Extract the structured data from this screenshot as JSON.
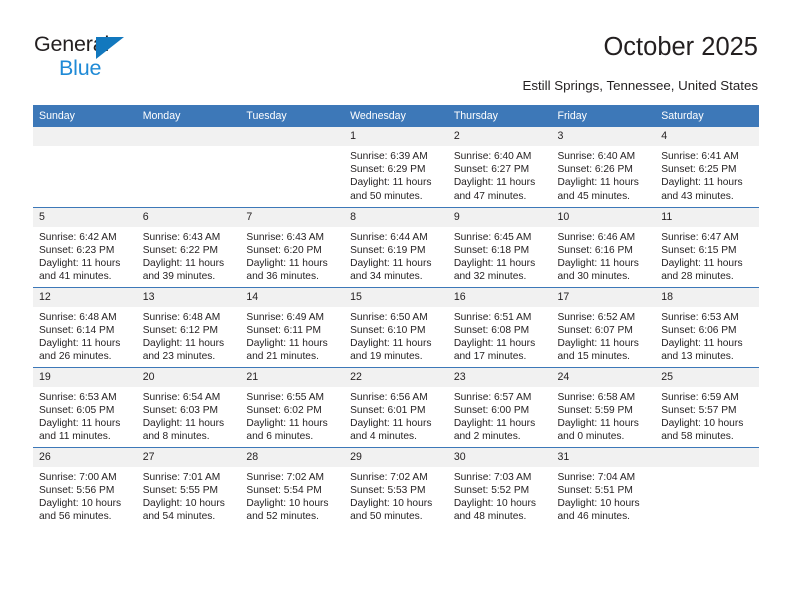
{
  "brand": {
    "name_part1": "General",
    "name_part2": "Blue",
    "triangle_color": "#1278be",
    "blue_text_color": "#1f8ad6"
  },
  "header": {
    "title": "October 2025",
    "location": "Estill Springs, Tennessee, United States"
  },
  "theme": {
    "header_blue": "#3d78b8",
    "daynum_band": "#f1f1f1",
    "text": "#231f20"
  },
  "calendar": {
    "weekday_headers": [
      "Sunday",
      "Monday",
      "Tuesday",
      "Wednesday",
      "Thursday",
      "Friday",
      "Saturday"
    ],
    "weeks": [
      [
        {
          "day": "",
          "sunrise": "",
          "sunset": "",
          "daylight_line1": "",
          "daylight_line2": ""
        },
        {
          "day": "",
          "sunrise": "",
          "sunset": "",
          "daylight_line1": "",
          "daylight_line2": ""
        },
        {
          "day": "",
          "sunrise": "",
          "sunset": "",
          "daylight_line1": "",
          "daylight_line2": ""
        },
        {
          "day": "1",
          "sunrise": "Sunrise: 6:39 AM",
          "sunset": "Sunset: 6:29 PM",
          "daylight_line1": "Daylight: 11 hours",
          "daylight_line2": "and 50 minutes."
        },
        {
          "day": "2",
          "sunrise": "Sunrise: 6:40 AM",
          "sunset": "Sunset: 6:27 PM",
          "daylight_line1": "Daylight: 11 hours",
          "daylight_line2": "and 47 minutes."
        },
        {
          "day": "3",
          "sunrise": "Sunrise: 6:40 AM",
          "sunset": "Sunset: 6:26 PM",
          "daylight_line1": "Daylight: 11 hours",
          "daylight_line2": "and 45 minutes."
        },
        {
          "day": "4",
          "sunrise": "Sunrise: 6:41 AM",
          "sunset": "Sunset: 6:25 PM",
          "daylight_line1": "Daylight: 11 hours",
          "daylight_line2": "and 43 minutes."
        }
      ],
      [
        {
          "day": "5",
          "sunrise": "Sunrise: 6:42 AM",
          "sunset": "Sunset: 6:23 PM",
          "daylight_line1": "Daylight: 11 hours",
          "daylight_line2": "and 41 minutes."
        },
        {
          "day": "6",
          "sunrise": "Sunrise: 6:43 AM",
          "sunset": "Sunset: 6:22 PM",
          "daylight_line1": "Daylight: 11 hours",
          "daylight_line2": "and 39 minutes."
        },
        {
          "day": "7",
          "sunrise": "Sunrise: 6:43 AM",
          "sunset": "Sunset: 6:20 PM",
          "daylight_line1": "Daylight: 11 hours",
          "daylight_line2": "and 36 minutes."
        },
        {
          "day": "8",
          "sunrise": "Sunrise: 6:44 AM",
          "sunset": "Sunset: 6:19 PM",
          "daylight_line1": "Daylight: 11 hours",
          "daylight_line2": "and 34 minutes."
        },
        {
          "day": "9",
          "sunrise": "Sunrise: 6:45 AM",
          "sunset": "Sunset: 6:18 PM",
          "daylight_line1": "Daylight: 11 hours",
          "daylight_line2": "and 32 minutes."
        },
        {
          "day": "10",
          "sunrise": "Sunrise: 6:46 AM",
          "sunset": "Sunset: 6:16 PM",
          "daylight_line1": "Daylight: 11 hours",
          "daylight_line2": "and 30 minutes."
        },
        {
          "day": "11",
          "sunrise": "Sunrise: 6:47 AM",
          "sunset": "Sunset: 6:15 PM",
          "daylight_line1": "Daylight: 11 hours",
          "daylight_line2": "and 28 minutes."
        }
      ],
      [
        {
          "day": "12",
          "sunrise": "Sunrise: 6:48 AM",
          "sunset": "Sunset: 6:14 PM",
          "daylight_line1": "Daylight: 11 hours",
          "daylight_line2": "and 26 minutes."
        },
        {
          "day": "13",
          "sunrise": "Sunrise: 6:48 AM",
          "sunset": "Sunset: 6:12 PM",
          "daylight_line1": "Daylight: 11 hours",
          "daylight_line2": "and 23 minutes."
        },
        {
          "day": "14",
          "sunrise": "Sunrise: 6:49 AM",
          "sunset": "Sunset: 6:11 PM",
          "daylight_line1": "Daylight: 11 hours",
          "daylight_line2": "and 21 minutes."
        },
        {
          "day": "15",
          "sunrise": "Sunrise: 6:50 AM",
          "sunset": "Sunset: 6:10 PM",
          "daylight_line1": "Daylight: 11 hours",
          "daylight_line2": "and 19 minutes."
        },
        {
          "day": "16",
          "sunrise": "Sunrise: 6:51 AM",
          "sunset": "Sunset: 6:08 PM",
          "daylight_line1": "Daylight: 11 hours",
          "daylight_line2": "and 17 minutes."
        },
        {
          "day": "17",
          "sunrise": "Sunrise: 6:52 AM",
          "sunset": "Sunset: 6:07 PM",
          "daylight_line1": "Daylight: 11 hours",
          "daylight_line2": "and 15 minutes."
        },
        {
          "day": "18",
          "sunrise": "Sunrise: 6:53 AM",
          "sunset": "Sunset: 6:06 PM",
          "daylight_line1": "Daylight: 11 hours",
          "daylight_line2": "and 13 minutes."
        }
      ],
      [
        {
          "day": "19",
          "sunrise": "Sunrise: 6:53 AM",
          "sunset": "Sunset: 6:05 PM",
          "daylight_line1": "Daylight: 11 hours",
          "daylight_line2": "and 11 minutes."
        },
        {
          "day": "20",
          "sunrise": "Sunrise: 6:54 AM",
          "sunset": "Sunset: 6:03 PM",
          "daylight_line1": "Daylight: 11 hours",
          "daylight_line2": "and 8 minutes."
        },
        {
          "day": "21",
          "sunrise": "Sunrise: 6:55 AM",
          "sunset": "Sunset: 6:02 PM",
          "daylight_line1": "Daylight: 11 hours",
          "daylight_line2": "and 6 minutes."
        },
        {
          "day": "22",
          "sunrise": "Sunrise: 6:56 AM",
          "sunset": "Sunset: 6:01 PM",
          "daylight_line1": "Daylight: 11 hours",
          "daylight_line2": "and 4 minutes."
        },
        {
          "day": "23",
          "sunrise": "Sunrise: 6:57 AM",
          "sunset": "Sunset: 6:00 PM",
          "daylight_line1": "Daylight: 11 hours",
          "daylight_line2": "and 2 minutes."
        },
        {
          "day": "24",
          "sunrise": "Sunrise: 6:58 AM",
          "sunset": "Sunset: 5:59 PM",
          "daylight_line1": "Daylight: 11 hours",
          "daylight_line2": "and 0 minutes."
        },
        {
          "day": "25",
          "sunrise": "Sunrise: 6:59 AM",
          "sunset": "Sunset: 5:57 PM",
          "daylight_line1": "Daylight: 10 hours",
          "daylight_line2": "and 58 minutes."
        }
      ],
      [
        {
          "day": "26",
          "sunrise": "Sunrise: 7:00 AM",
          "sunset": "Sunset: 5:56 PM",
          "daylight_line1": "Daylight: 10 hours",
          "daylight_line2": "and 56 minutes."
        },
        {
          "day": "27",
          "sunrise": "Sunrise: 7:01 AM",
          "sunset": "Sunset: 5:55 PM",
          "daylight_line1": "Daylight: 10 hours",
          "daylight_line2": "and 54 minutes."
        },
        {
          "day": "28",
          "sunrise": "Sunrise: 7:02 AM",
          "sunset": "Sunset: 5:54 PM",
          "daylight_line1": "Daylight: 10 hours",
          "daylight_line2": "and 52 minutes."
        },
        {
          "day": "29",
          "sunrise": "Sunrise: 7:02 AM",
          "sunset": "Sunset: 5:53 PM",
          "daylight_line1": "Daylight: 10 hours",
          "daylight_line2": "and 50 minutes."
        },
        {
          "day": "30",
          "sunrise": "Sunrise: 7:03 AM",
          "sunset": "Sunset: 5:52 PM",
          "daylight_line1": "Daylight: 10 hours",
          "daylight_line2": "and 48 minutes."
        },
        {
          "day": "31",
          "sunrise": "Sunrise: 7:04 AM",
          "sunset": "Sunset: 5:51 PM",
          "daylight_line1": "Daylight: 10 hours",
          "daylight_line2": "and 46 minutes."
        },
        {
          "day": "",
          "sunrise": "",
          "sunset": "",
          "daylight_line1": "",
          "daylight_line2": ""
        }
      ]
    ]
  }
}
